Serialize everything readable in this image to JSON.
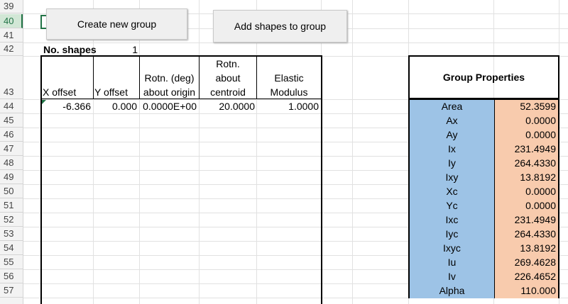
{
  "row_numbers": [
    "39",
    "40",
    "41",
    "42",
    "43",
    "44",
    "45",
    "46",
    "47",
    "48",
    "49",
    "50",
    "51",
    "52",
    "53",
    "54",
    "55",
    "56",
    "57"
  ],
  "buttons": {
    "create_group": "Create new group",
    "add_shapes": "Add shapes to group"
  },
  "no_shapes": {
    "label": "No. shapes",
    "value": "1"
  },
  "shape_table": {
    "headers": {
      "x_offset": "X offset",
      "y_offset": "Y offset",
      "rotn_origin_1": "Rotn. (deg)",
      "rotn_origin_2": "about origin",
      "rotn_centroid_1": "Rotn.",
      "rotn_centroid_2": "about",
      "rotn_centroid_3": "centroid",
      "elastic_1": "Elastic",
      "elastic_2": "Modulus"
    },
    "row": {
      "x_offset": "-6.366",
      "y_offset": "0.000",
      "rotn_origin": "0.0000E+00",
      "rotn_centroid": "20.0000",
      "elastic": "1.0000"
    }
  },
  "group_properties": {
    "title": "Group Properties",
    "rows": [
      {
        "name": "Area",
        "value": "52.3599"
      },
      {
        "name": "Ax",
        "value": "0.0000"
      },
      {
        "name": "Ay",
        "value": "0.0000"
      },
      {
        "name": "Ix",
        "value": "231.4949"
      },
      {
        "name": "Iy",
        "value": "264.4330"
      },
      {
        "name": "Ixy",
        "value": "13.8192"
      },
      {
        "name": "Xc",
        "value": "0.0000"
      },
      {
        "name": "Yc",
        "value": "0.0000"
      },
      {
        "name": "Ixc",
        "value": "231.4949"
      },
      {
        "name": "Iyc",
        "value": "264.4330"
      },
      {
        "name": "Ixyc",
        "value": "13.8192"
      },
      {
        "name": "Iu",
        "value": "269.4628"
      },
      {
        "name": "Iv",
        "value": "226.4652"
      },
      {
        "name": "Alpha",
        "value": "110.000"
      }
    ],
    "colors": {
      "name_bg": "#9dc3e6",
      "value_bg": "#f8cbad"
    }
  }
}
